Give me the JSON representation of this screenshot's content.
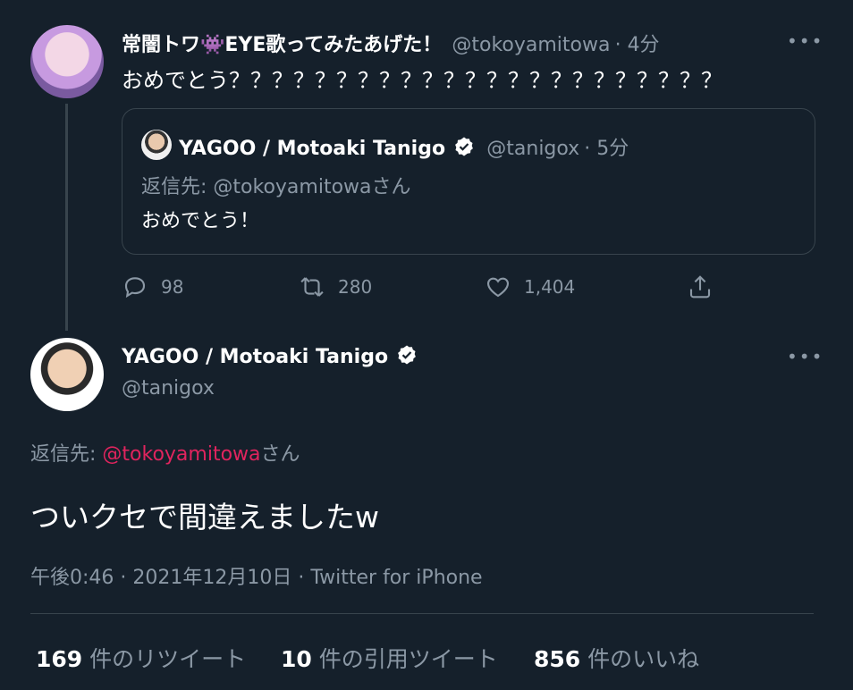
{
  "parent_tweet": {
    "display_name": "常闇トワ👾EYE歌ってみたあげた！",
    "handle": "@tokoyamitowa",
    "time": "· 4分",
    "text": "おめでとう？？？？？？？？？？？？？？？？？？？？？？？",
    "more": "•••",
    "quoted": {
      "display_name": "YAGOO / Motoaki Tanigo",
      "handle": "@tanigox",
      "time": "· 5分",
      "reply_to": "返信先: @tokoyamitowaさん",
      "text": "おめでとう！"
    },
    "actions": {
      "reply_count": "98",
      "retweet_count": "280",
      "like_count": "1,404"
    }
  },
  "main_tweet": {
    "display_name": "YAGOO / Motoaki Tanigo",
    "handle": "@tanigox",
    "more": "•••",
    "reply_prefix": "返信先: ",
    "reply_mention": "@tokoyamitowa",
    "reply_suffix": "さん",
    "text": "ついクセで間違えましたw",
    "timestamp": "午後0:46 · 2021年12月10日 · Twitter for iPhone"
  },
  "stats": {
    "retweets_num": "169",
    "retweets_label": " 件のリツイート",
    "quotes_num": "10",
    "quotes_label": " 件の引用ツイート",
    "likes_num": "856",
    "likes_label": " 件のいいね"
  },
  "colors": {
    "background": "#15202b",
    "muted": "#8b98a5",
    "mention": "#e0245e",
    "border": "#38444d"
  }
}
